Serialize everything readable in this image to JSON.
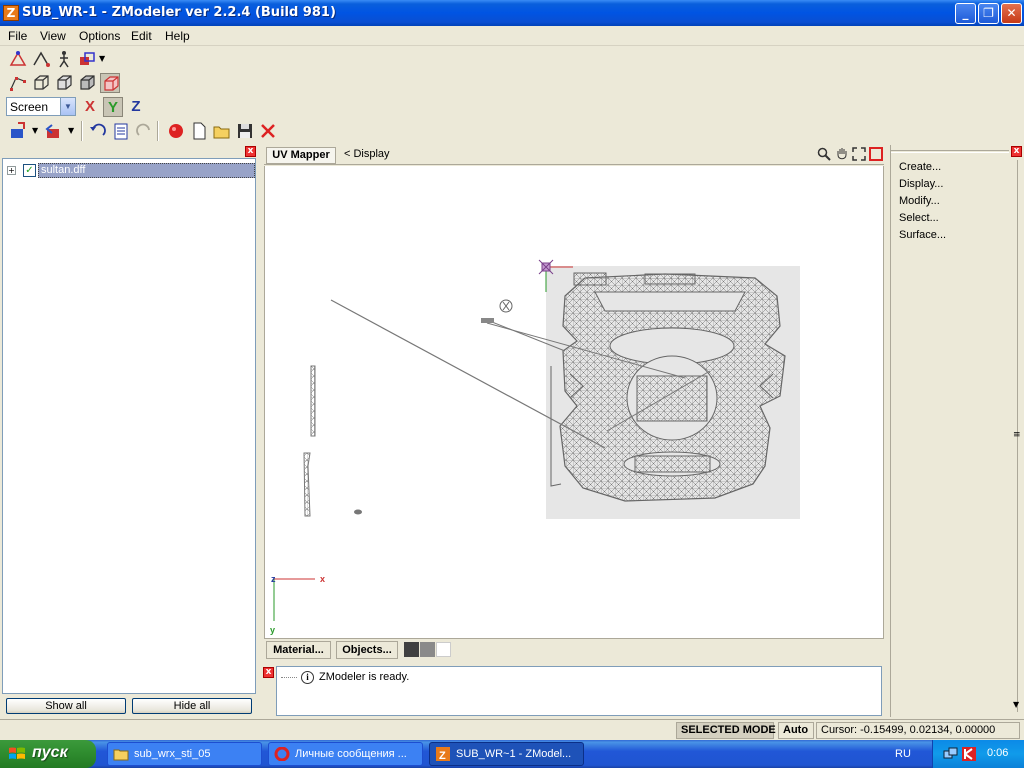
{
  "window": {
    "title": "SUB_WR-1 - ZModeler ver 2.2.4 (Build 981)",
    "app_icon_letter": "Z"
  },
  "menu": [
    "File",
    "View",
    "Options",
    "Edit",
    "Help"
  ],
  "axis_toolbar": {
    "space_select": "Screen",
    "x": "X",
    "y": "Y",
    "z": "Z"
  },
  "tree": {
    "items": [
      {
        "label": "sultan.dff",
        "checked": true
      }
    ],
    "show_all": "Show all",
    "hide_all": "Hide all"
  },
  "viewport": {
    "tab": "UV Mapper",
    "breadcrumb": "< Display",
    "axis_labels": {
      "z": "z",
      "x": "x",
      "y": "y"
    },
    "footer": {
      "material": "Material...",
      "objects": "Objects..."
    },
    "swatches": [
      "#404040",
      "#8a8a8a",
      "#ffffff"
    ]
  },
  "log": {
    "message": "ZModeler is ready."
  },
  "commands": [
    "Create...",
    "Display...",
    "Modify...",
    "Select...",
    "Surface..."
  ],
  "status": {
    "mode": "SELECTED MODE",
    "auto": "Auto",
    "cursor": "Cursor: -0.15499, 0.02134, 0.00000"
  },
  "taskbar": {
    "start": "пуск",
    "tasks": [
      {
        "label": "sub_wrx_sti_05",
        "active": false
      },
      {
        "label": "Личные сообщения ...",
        "active": false
      },
      {
        "label": "SUB_WR~1 - ZModel...",
        "active": true
      }
    ],
    "lang": "RU",
    "clock": "0:06"
  },
  "colors": {
    "title_blue": "#0054e3",
    "taskbar_blue": "#2157d7",
    "uv_background": "#e6e6e6",
    "wire": "#707070"
  }
}
